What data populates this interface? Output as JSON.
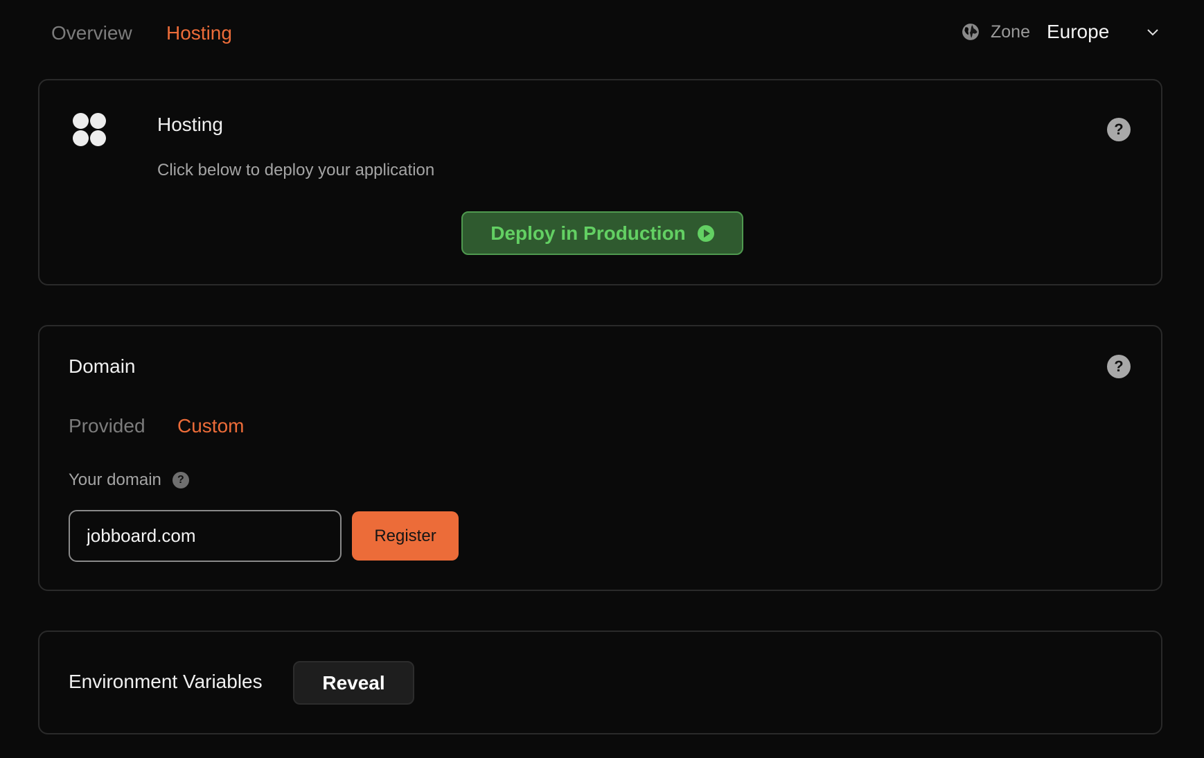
{
  "nav": {
    "tabs": [
      {
        "label": "Overview",
        "active": false
      },
      {
        "label": "Hosting",
        "active": true
      }
    ],
    "zone": {
      "icon": "globe-icon",
      "label": "Zone",
      "value": "Europe",
      "dropdown_icon": "chevron-down-icon"
    }
  },
  "hosting_card": {
    "logo_icon": "four-dots-logo-icon",
    "title": "Hosting",
    "description": "Click below to deploy your application",
    "help_icon": "?",
    "deploy_button": {
      "label": "Deploy in Production",
      "icon": "play-circle-icon"
    }
  },
  "domain_card": {
    "title": "Domain",
    "help_icon": "?",
    "tabs": [
      {
        "label": "Provided",
        "active": false
      },
      {
        "label": "Custom",
        "active": true
      }
    ],
    "field_label": "Your domain",
    "field_help_icon": "?",
    "input_value": "jobboard.com",
    "register_label": "Register"
  },
  "env_card": {
    "title": "Environment Variables",
    "reveal_label": "Reveal"
  },
  "colors": {
    "accent": "#ec6c39",
    "success": "#63d063",
    "success_bg": "#2f5a2f",
    "background": "#0a0a0a",
    "border": "#2a2a2a"
  }
}
